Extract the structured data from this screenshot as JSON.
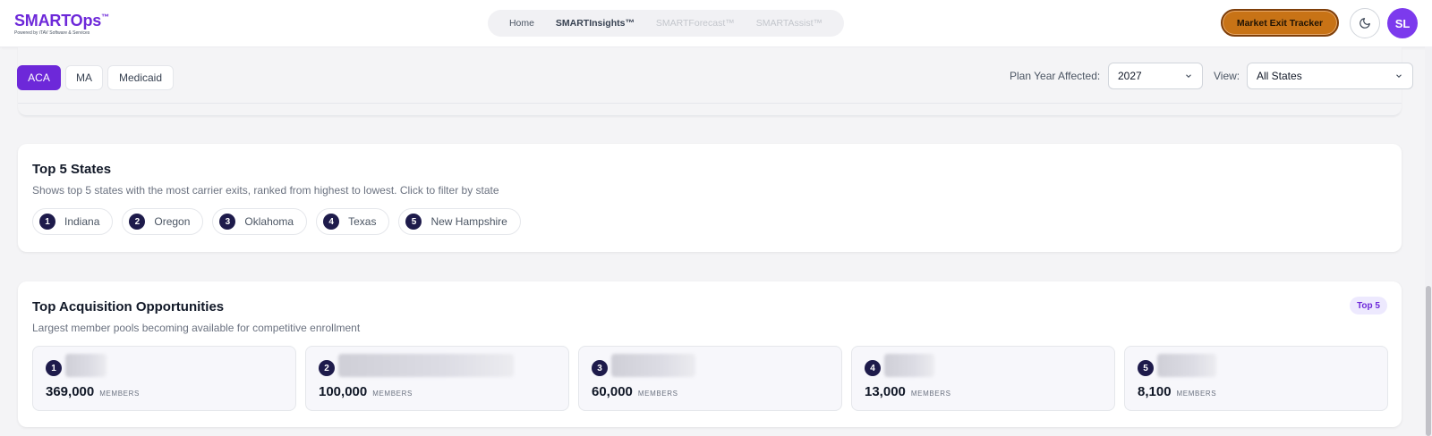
{
  "header": {
    "logo_text": "SMARTOps",
    "logo_tm": "™",
    "logo_sub": "Powered by iTAV Software & Services",
    "nav": [
      {
        "label": "Home",
        "state": "normal"
      },
      {
        "label": "SMARTInsights™",
        "state": "active"
      },
      {
        "label": "SMARTForecast™",
        "state": "disabled"
      },
      {
        "label": "SMARTAssist™",
        "state": "disabled"
      }
    ],
    "exit_button": "Market Exit Tracker",
    "theme_icon": "moon-icon",
    "avatar_initials": "SL"
  },
  "filters": {
    "segments": [
      "ACA",
      "MA",
      "Medicaid"
    ],
    "active_segment": "ACA",
    "plan_year_label": "Plan Year Affected:",
    "plan_year_value": "2027",
    "view_label": "View:",
    "view_value": "All States"
  },
  "top_states": {
    "title": "Top 5 States",
    "subtitle": "Shows top 5 states with the most carrier exits, ranked from highest to lowest. Click to filter by state",
    "items": [
      {
        "rank": "1",
        "name": "Indiana"
      },
      {
        "rank": "2",
        "name": "Oregon"
      },
      {
        "rank": "3",
        "name": "Oklahoma"
      },
      {
        "rank": "4",
        "name": "Texas"
      },
      {
        "rank": "5",
        "name": "New Hampshire"
      }
    ]
  },
  "acquisition": {
    "title": "Top Acquisition Opportunities",
    "subtitle": "Largest member pools becoming available for competitive enrollment",
    "badge": "Top 5",
    "unit": "MEMBERS",
    "items": [
      {
        "rank": "1",
        "members": "369,000"
      },
      {
        "rank": "2",
        "members": "100,000"
      },
      {
        "rank": "3",
        "members": "60,000"
      },
      {
        "rank": "4",
        "members": "13,000"
      },
      {
        "rank": "5",
        "members": "8,100"
      }
    ]
  },
  "colors": {
    "brand_purple": "#6d28d9",
    "exit_orange": "#c87316",
    "rank_navy": "#1e1b4b"
  }
}
